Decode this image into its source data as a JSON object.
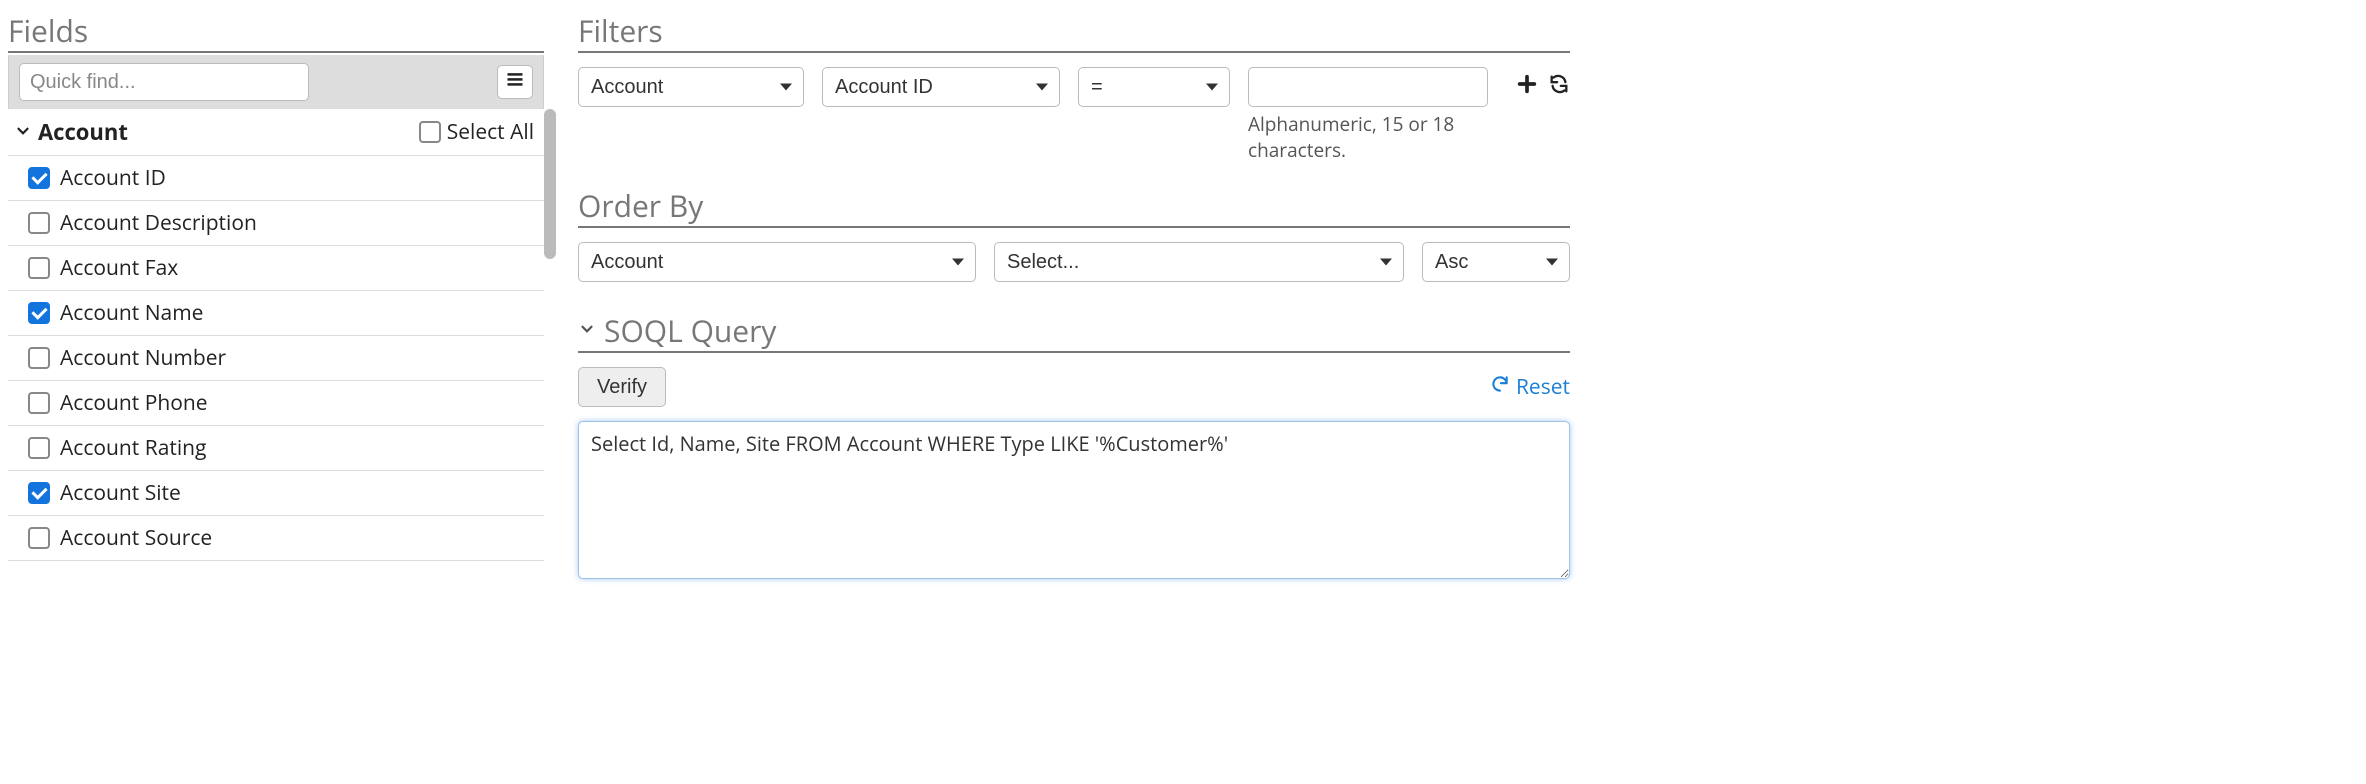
{
  "fields": {
    "heading": "Fields",
    "quickfind_placeholder": "Quick find...",
    "group_name": "Account",
    "select_all_label": "Select All",
    "items": [
      {
        "label": "Account ID",
        "checked": true
      },
      {
        "label": "Account Description",
        "checked": false
      },
      {
        "label": "Account Fax",
        "checked": false
      },
      {
        "label": "Account Name",
        "checked": true
      },
      {
        "label": "Account Number",
        "checked": false
      },
      {
        "label": "Account Phone",
        "checked": false
      },
      {
        "label": "Account Rating",
        "checked": false
      },
      {
        "label": "Account Site",
        "checked": true
      },
      {
        "label": "Account Source",
        "checked": false
      }
    ]
  },
  "filters": {
    "heading": "Filters",
    "object_value": "Account",
    "field_value": "Account ID",
    "operator_value": "=",
    "value": "",
    "hint": "Alphanumeric, 15 or 18 characters."
  },
  "orderby": {
    "heading": "Order By",
    "object_value": "Account",
    "field_value": "Select...",
    "direction_value": "Asc"
  },
  "soql": {
    "heading": "SOQL Query",
    "verify_label": "Verify",
    "reset_label": "Reset",
    "query": "Select Id, Name, Site FROM Account WHERE Type LIKE '%Customer%'"
  }
}
